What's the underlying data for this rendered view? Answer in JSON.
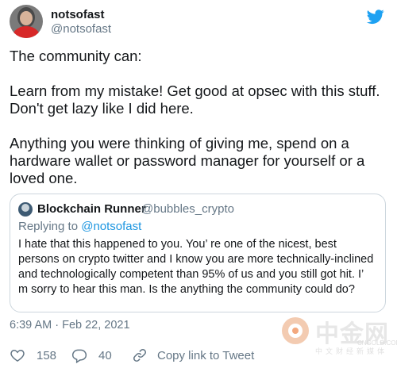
{
  "author": {
    "display_name": "notsofast",
    "handle": "@notsofast"
  },
  "tweet": {
    "paragraphs": [
      "The community can:",
      "Learn from my mistake! Get good at opsec with this stuff. Don't get lazy like I did here.",
      "Anything you were thinking of giving me, spend on a hardware wallet or password manager for yourself or a loved one."
    ]
  },
  "quoted": {
    "display_name": "Blockchain Runner",
    "handle": "@bubbles_crypto",
    "replying_prefix": "Replying to",
    "replying_to": "@notsofast",
    "text": "I hate that this happened to you. You’ re one of the nicest, best persons on crypto twitter and I know you are more technically-inclined and technologically competent than 95% of us and you still got hit. I’ m sorry to hear this man. Is the anything the community could do?"
  },
  "timestamp": "6:39 AM · Feb 22, 2021",
  "actions": {
    "likes": "158",
    "replies": "40",
    "copy_link": "Copy link to Tweet"
  },
  "watermark": {
    "big": "中金网",
    "small": "CNGOLD.COM",
    "sub": "中文财经新媒体"
  },
  "colors": {
    "twitter_blue": "#1da1f2",
    "muted": "#657786",
    "text": "#14171a"
  },
  "icons": [
    "twitter-bird-icon",
    "heart-icon",
    "reply-icon",
    "link-icon"
  ]
}
